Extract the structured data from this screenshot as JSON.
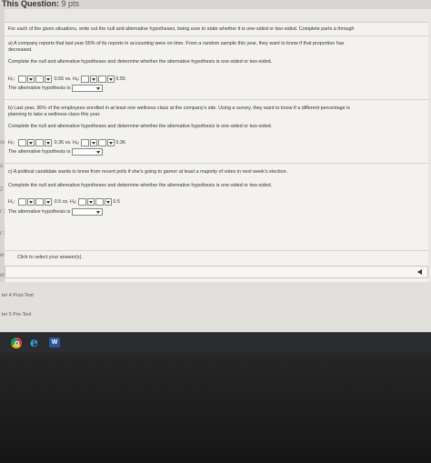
{
  "header": {
    "label": "This Question:",
    "points": "9 pts"
  },
  "left_rail": [
    "ce",
    "s",
    "2",
    "r 2",
    "r 3",
    "er 3",
    "er 4"
  ],
  "instructions": "For each of the given situations, write out the null and alternative hypotheses, being sure to state whether it is one-sided or two-sided. Complete parts a through",
  "part_a": {
    "text1": "a) A company reports that last year 55% of its reports in accounting were on time. From a random sample this year, they want to know if that proportion has",
    "text2": "decreased.",
    "prompt": "Complete the null and alternative hypotheses and determine whether the alternative hypothesis is one-sided or two-sided.",
    "h0": "H₀:",
    "vs": "0.55 vs. Hₐ:",
    "value": "0.55",
    "alt_label": "The alternative hypothesis is"
  },
  "part_b": {
    "text1": "b) Last year, 36% of the employees enrolled in at least one wellness class at the company's site. Using a survey, they want to know if a different percentage is",
    "text2": "planning to take a wellness class this year.",
    "prompt": "Complete the null and alternative hypotheses and determine whether the alternative hypothesis is one-sided or two-sided.",
    "h0": "H₀:",
    "vs": "0.36 vs. Hₐ:",
    "value": "0.36",
    "alt_label": "The alternative hypothesis is"
  },
  "part_c": {
    "text1": "c) A political candidate wants to know from recent polls if she's going to garner at least a majority of votes in next week's election.",
    "prompt": "Complete the null and alternative hypotheses and determine whether the alternative hypothesis is one-sided or two-sided.",
    "h0": "H₀:",
    "vs": "0.5 vs. Hₐ:",
    "value": "0.5",
    "alt_label": "The alternative hypothesis is"
  },
  "footer_hint": "Click to select your answer(s).",
  "bottom_list": [
    "ter 4 Post-Test",
    "ter 5 Pre-Test"
  ],
  "taskbar": {
    "word_label": "W"
  }
}
